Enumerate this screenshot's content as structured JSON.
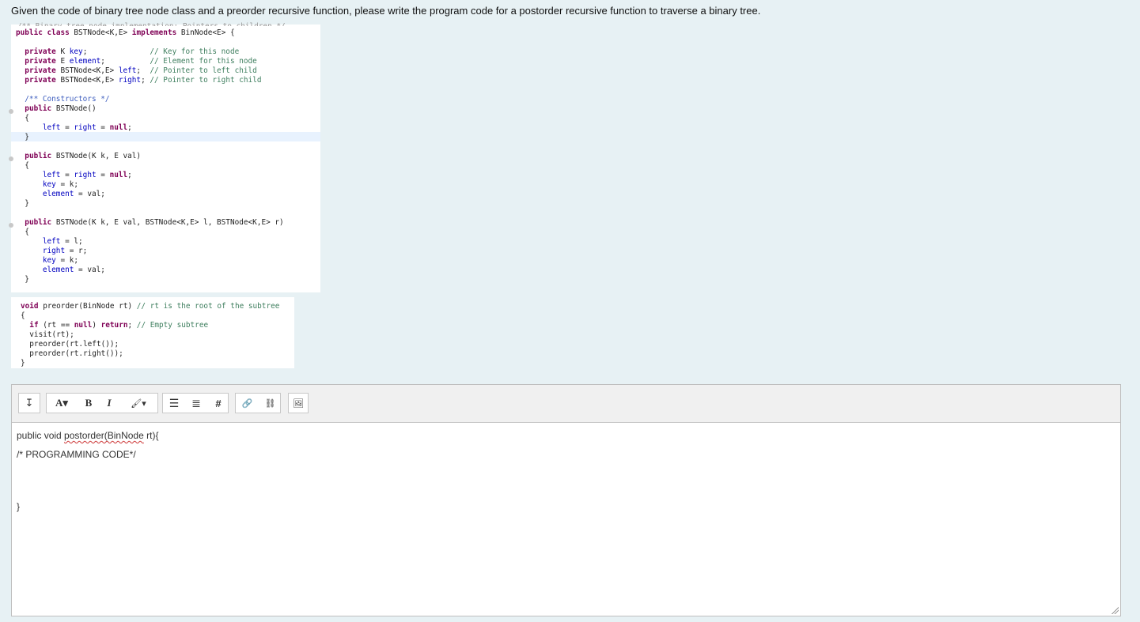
{
  "question": "Given the code of binary tree node class and a preorder recursive function, please write the program code for a postorder recursive function to traverse a binary tree.",
  "class_code": {
    "cut_line": "/** Binary tree node implementation: Pointers to children */",
    "lines": [
      "public class BSTNode<K,E> implements BinNode<E> {",
      "",
      "  private K key;              // Key for this node",
      "  private E element;          // Element for this node",
      "  private BSTNode<K,E> left;  // Pointer to left child",
      "  private BSTNode<K,E> right; // Pointer to right child",
      "",
      "  /** Constructors */",
      "  public BSTNode()",
      "  {",
      "      left = right = null;",
      "  }",
      "",
      "  public BSTNode(K k, E val)",
      "  {",
      "      left = right = null;",
      "      key = k;",
      "      element = val;",
      "  }",
      "",
      "  public BSTNode(K k, E val, BSTNode<K,E> l, BSTNode<K,E> r)",
      "  {",
      "      left = l;",
      "      right = r;",
      "      key = k;",
      "      element = val;",
      "  }"
    ]
  },
  "preorder_code": {
    "lines": [
      "void preorder(BinNode rt) // rt is the root of the subtree",
      "{",
      "  if (rt == null) return; // Empty subtree",
      "  visit(rt);",
      "  preorder(rt.left());",
      "  preorder(rt.right());",
      "}"
    ]
  },
  "toolbar": {
    "buttons": [
      {
        "name": "collapse-toolbar-button",
        "label": "↧"
      },
      {
        "name": "font-style-button",
        "label": "A▾"
      },
      {
        "name": "bold-button",
        "label": "B"
      },
      {
        "name": "italic-button",
        "label": "I"
      },
      {
        "name": "color-brush-button",
        "label": "🖌▾"
      },
      {
        "name": "unordered-list-button",
        "label": "☰"
      },
      {
        "name": "ordered-list-button",
        "label": "≣"
      },
      {
        "name": "equation-button",
        "label": "#"
      },
      {
        "name": "insert-link-button",
        "label": "🔗"
      },
      {
        "name": "unlink-button",
        "label": "⛓"
      },
      {
        "name": "insert-image-button",
        "label": "🖼"
      }
    ]
  },
  "editor": {
    "line1_prefix": "public void ",
    "line1_spell": "postorder(BinNode",
    "line1_suffix": " rt){",
    "line2": "/* PROGRAMMING CODE*/",
    "line3": "}"
  },
  "colors": {
    "background": "#e7f1f4",
    "keyword": "#7f0055",
    "comment": "#3f7f5f",
    "field": "#0000c0"
  }
}
